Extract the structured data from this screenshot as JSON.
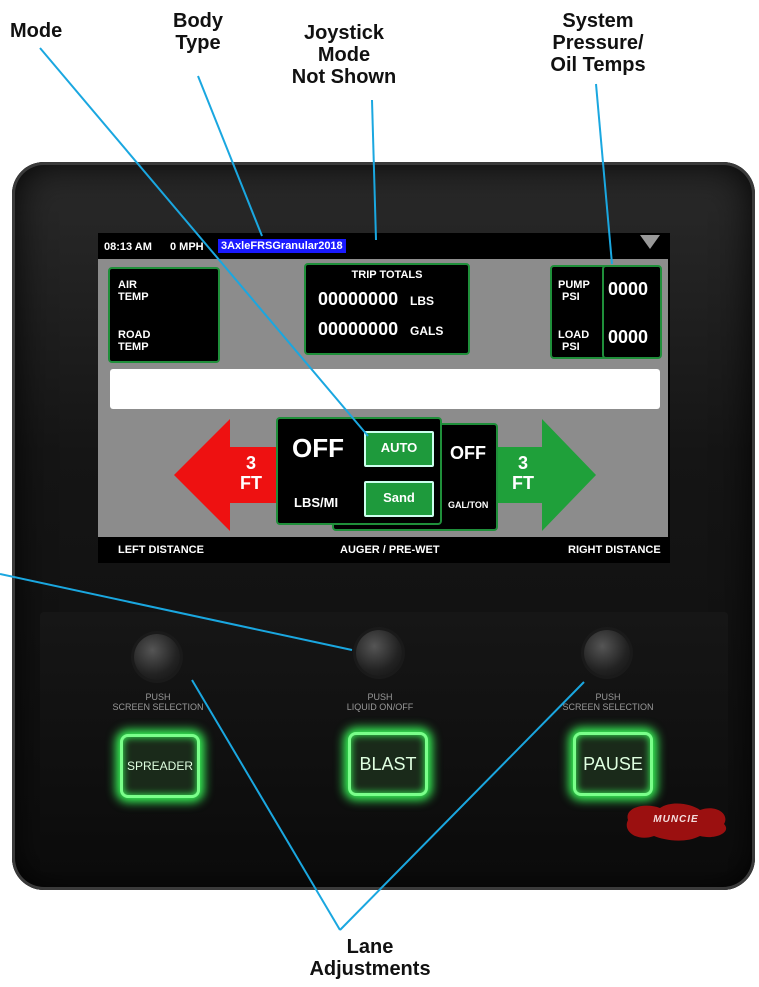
{
  "callouts": {
    "mode": "Mode",
    "body_type_1": "Body",
    "body_type_2": "Type",
    "joystick_1": "Joystick",
    "joystick_2": "Mode",
    "joystick_3": "Not Shown",
    "system_1": "System",
    "system_2": "Pressure/",
    "system_3": "Oil Temps",
    "lane_1": "Lane",
    "lane_2": "Adjustments"
  },
  "status": {
    "time": "08:13 AM",
    "speed": "0 MPH",
    "body_type": "3AxleFRSGranular2018"
  },
  "temps": {
    "air_1": "AIR",
    "air_2": "TEMP",
    "road_1": "ROAD",
    "road_2": "TEMP"
  },
  "trip": {
    "title": "TRIP TOTALS",
    "lbs_value": "00000000",
    "lbs_unit": "LBS",
    "gals_value": "00000000",
    "gals_unit": "GALS"
  },
  "pressure": {
    "pump_1": "PUMP",
    "pump_2": "PSI",
    "pump_value": "0000",
    "load_1": "LOAD",
    "load_2": "PSI",
    "load_value": "0000"
  },
  "auger": {
    "state": "OFF",
    "unit": "LBS/MI",
    "mode_button": "AUTO",
    "material_button": "Sand"
  },
  "prewet": {
    "state": "OFF",
    "unit": "GAL/TON"
  },
  "left_lane": {
    "value": "3",
    "unit": "FT"
  },
  "right_lane": {
    "value": "3",
    "unit": "FT"
  },
  "bottom": {
    "left": "LEFT DISTANCE",
    "center": "AUGER / PRE-WET",
    "right": "RIGHT DISTANCE"
  },
  "knobs": {
    "left_1": "PUSH",
    "left_2": "SCREEN SELECTION",
    "center_1": "PUSH",
    "center_2": "LIQUID ON/OFF",
    "right_1": "PUSH",
    "right_2": "SCREEN SELECTION"
  },
  "buttons": {
    "spreader": "SPREADER",
    "blast": "BLAST",
    "pause": "PAUSE"
  },
  "logo_text": "MUNCIE",
  "colors": {
    "left_arrow": "#ee1111",
    "right_arrow": "#1fa03a",
    "button_green": "#1e9a3c",
    "body_type_highlight": "#1a1aff",
    "callout_line": "#1aa7e0",
    "button_glow": "#39ff5a"
  }
}
